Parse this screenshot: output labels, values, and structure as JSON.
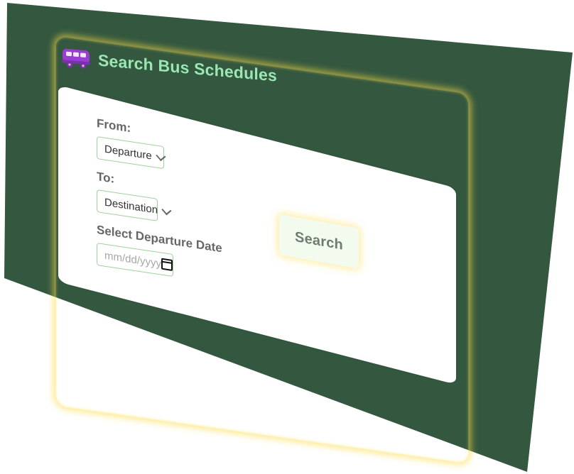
{
  "header": {
    "title": "Search Bus Schedules",
    "icon": "bus-icon"
  },
  "form": {
    "from_label": "From:",
    "from_value": "Departure",
    "to_label": "To:",
    "to_value": "Destination",
    "date_label": "Select Departure Date",
    "date_placeholder": "mm/dd/yyyy"
  },
  "actions": {
    "search_label": "Search"
  },
  "colors": {
    "panel": "#33573f",
    "title": "#9be7b3",
    "icon": "#9a3dd1",
    "glow": "#fade46"
  }
}
